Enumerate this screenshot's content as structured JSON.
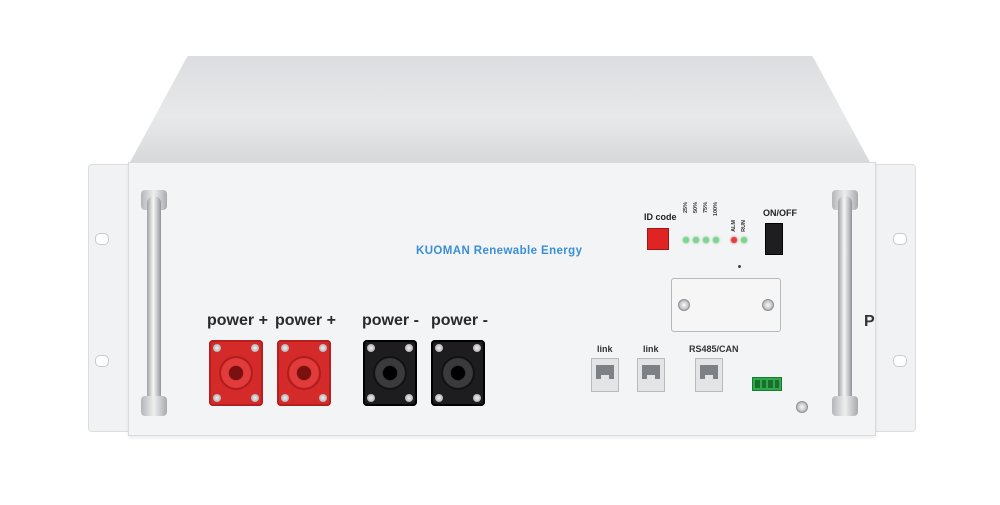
{
  "brand": {
    "text": "KUOMAN Renewable Energy",
    "color": "#3a8fd6"
  },
  "terminals": [
    {
      "label": "power +",
      "color": "red"
    },
    {
      "label": "power +",
      "color": "red"
    },
    {
      "label": "power -",
      "color": "black"
    },
    {
      "label": "power -",
      "color": "black"
    }
  ],
  "ports": [
    {
      "label": "link"
    },
    {
      "label": "link"
    },
    {
      "label": "RS485/CAN"
    }
  ],
  "id_code": {
    "label": "ID code"
  },
  "soc_leds": {
    "labels": [
      "25%",
      "50%",
      "75%",
      "100%",
      "ALM",
      "RUN"
    ],
    "states": [
      "green",
      "green",
      "green",
      "green",
      "red",
      "green"
    ]
  },
  "power_switch": {
    "label": "ON/OFF"
  },
  "side_letter": "P",
  "colors": {
    "terminal_red": "#d42a2a",
    "terminal_black": "#1d1d1f",
    "connector_green": "#2fa84a",
    "id_switch_red": "#e02323"
  }
}
